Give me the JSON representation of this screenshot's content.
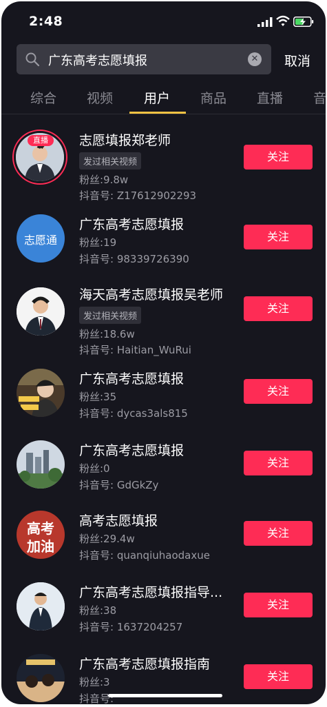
{
  "status_bar": {
    "time": "2:48"
  },
  "search": {
    "query": "广东高考志愿填报",
    "cancel_label": "取消"
  },
  "tabs": [
    {
      "label": "综合"
    },
    {
      "label": "视频"
    },
    {
      "label": "用户"
    },
    {
      "label": "商品"
    },
    {
      "label": "直播"
    },
    {
      "label": "音"
    }
  ],
  "active_tab": "用户",
  "results": [
    {
      "name": "志愿填报郑老师",
      "tag": "发过相关视频",
      "fans": "粉丝:9.8w",
      "douyin_id": "抖音号: Z17612902293",
      "follow_label": "关注",
      "live_badge": "直播"
    },
    {
      "name": "广东高考志愿填报",
      "fans": "粉丝:19",
      "douyin_id": "抖音号: 98339726390",
      "follow_label": "关注",
      "avatar_text": "志愿通"
    },
    {
      "name": "海天高考志愿填报吴老师",
      "tag": "发过相关视频",
      "fans": "粉丝:18.6w",
      "douyin_id": "抖音号: Haitian_WuRui",
      "follow_label": "关注"
    },
    {
      "name": "广东高考志愿填报",
      "fans": "粉丝:35",
      "douyin_id": "抖音号: dycas3als815",
      "follow_label": "关注"
    },
    {
      "name": "广东高考志愿填报",
      "fans": "粉丝:0",
      "douyin_id": "抖音号: GdGkZy",
      "follow_label": "关注"
    },
    {
      "name": "高考志愿填报",
      "fans": "粉丝:29.4w",
      "douyin_id": "抖音号: quanqiuhaodaxue",
      "follow_label": "关注",
      "avatar_text_1": "高考",
      "avatar_text_2": "加油"
    },
    {
      "name": "广东高考志愿填报指导...",
      "fans": "粉丝:38",
      "douyin_id": "抖音号: 1637204257",
      "follow_label": "关注"
    },
    {
      "name": "广东高考志愿填报指南",
      "fans": "粉丝:3",
      "douyin_id": "抖音号:",
      "follow_label": "关注"
    }
  ],
  "colors": {
    "background": "#16161e",
    "follow_button": "#fe2c55",
    "tab_indicator": "#f6c343",
    "search_field": "#3a3a43"
  }
}
